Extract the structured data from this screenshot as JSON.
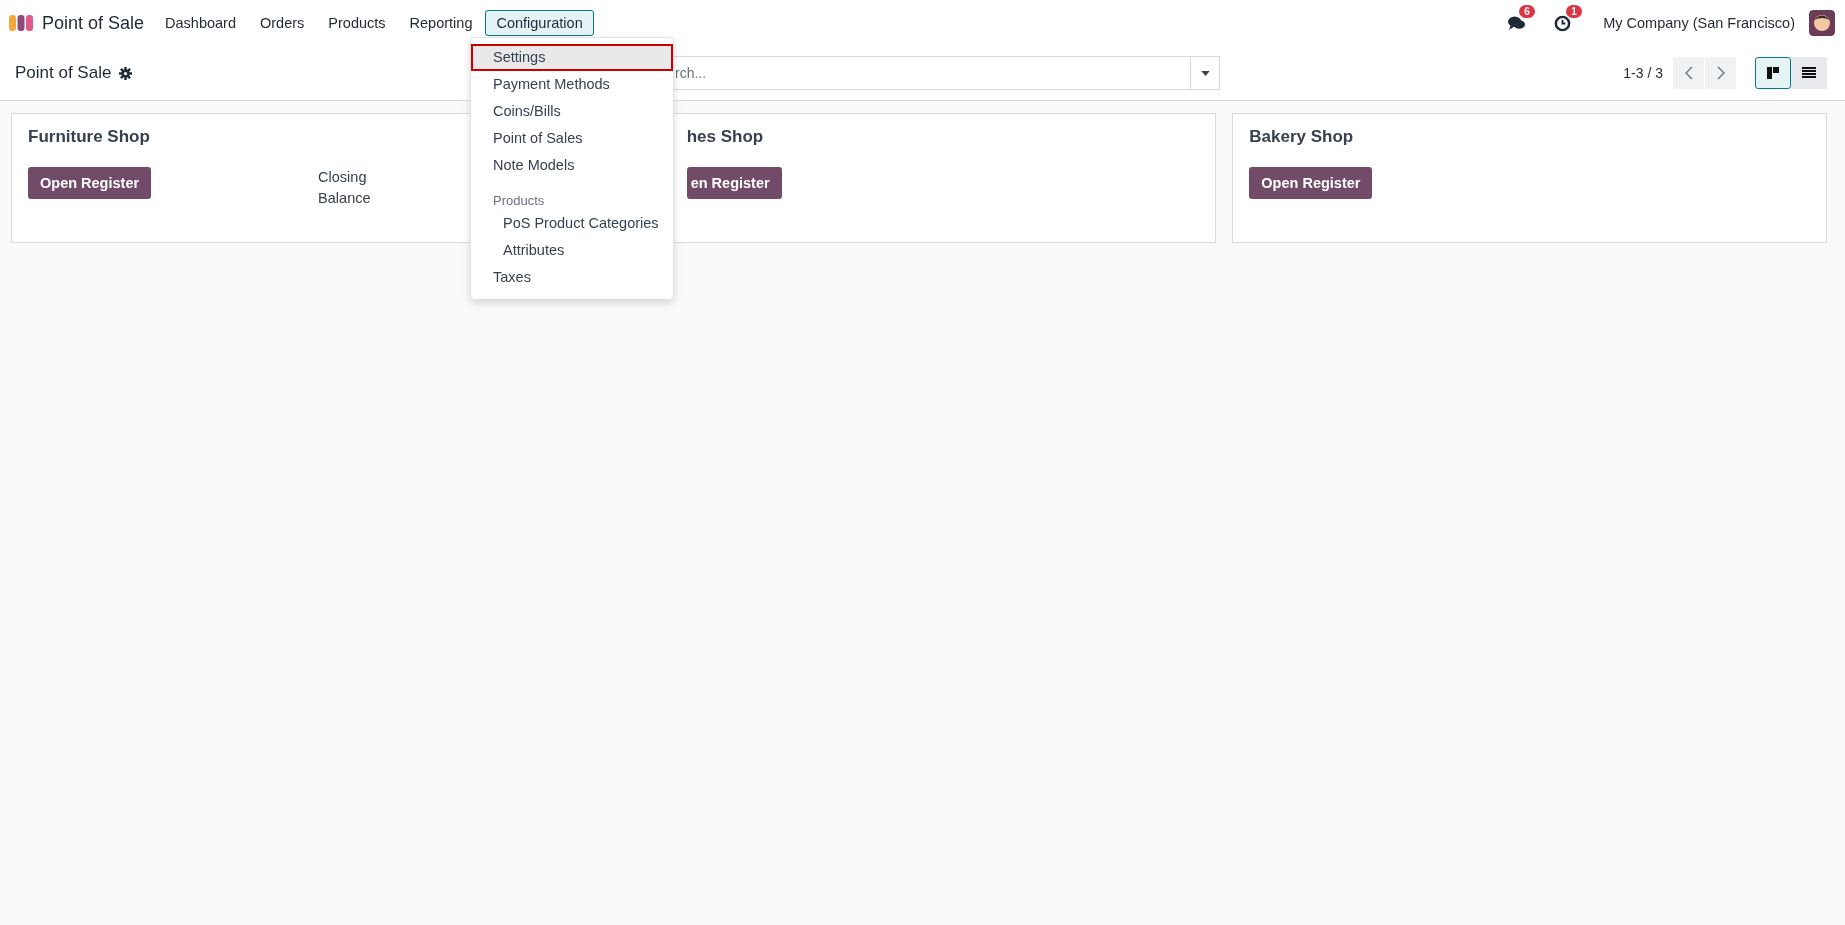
{
  "navbar": {
    "app_name": "Point of Sale",
    "menus": [
      {
        "label": "Dashboard",
        "selected": false
      },
      {
        "label": "Orders",
        "selected": false
      },
      {
        "label": "Products",
        "selected": false
      },
      {
        "label": "Reporting",
        "selected": false
      },
      {
        "label": "Configuration",
        "selected": true
      }
    ],
    "messages_count": "6",
    "activities_count": "1",
    "company": "My Company (San Francisco)"
  },
  "dropdown": {
    "items": [
      {
        "label": "Settings",
        "kind": "item",
        "selected": true
      },
      {
        "label": "Payment Methods",
        "kind": "item",
        "selected": false
      },
      {
        "label": "Coins/Bills",
        "kind": "item",
        "selected": false
      },
      {
        "label": "Point of Sales",
        "kind": "item",
        "selected": false
      },
      {
        "label": "Note Models",
        "kind": "item",
        "selected": false
      },
      {
        "label": "Products",
        "kind": "header",
        "children": [
          {
            "label": "PoS Product Categories",
            "kind": "item",
            "selected": false
          },
          {
            "label": "Attributes",
            "kind": "item",
            "selected": false
          }
        ]
      },
      {
        "label": "Taxes",
        "kind": "item",
        "selected": false
      }
    ]
  },
  "control_panel": {
    "title": "Point of Sale",
    "search": {
      "placeholder": "rch..."
    },
    "pager": "1-3 / 3",
    "views": [
      {
        "kind": "kanban",
        "selected": true
      },
      {
        "kind": "list",
        "selected": false
      }
    ]
  },
  "cards": [
    {
      "title": "Furniture Shop",
      "button": "Open Register",
      "field_label": "Closing\nBalance",
      "covered": false
    },
    {
      "title": "hes Shop",
      "button": "en Register",
      "covered": true
    },
    {
      "title": "Bakery Shop",
      "button": "Open Register",
      "covered": false
    }
  ]
}
